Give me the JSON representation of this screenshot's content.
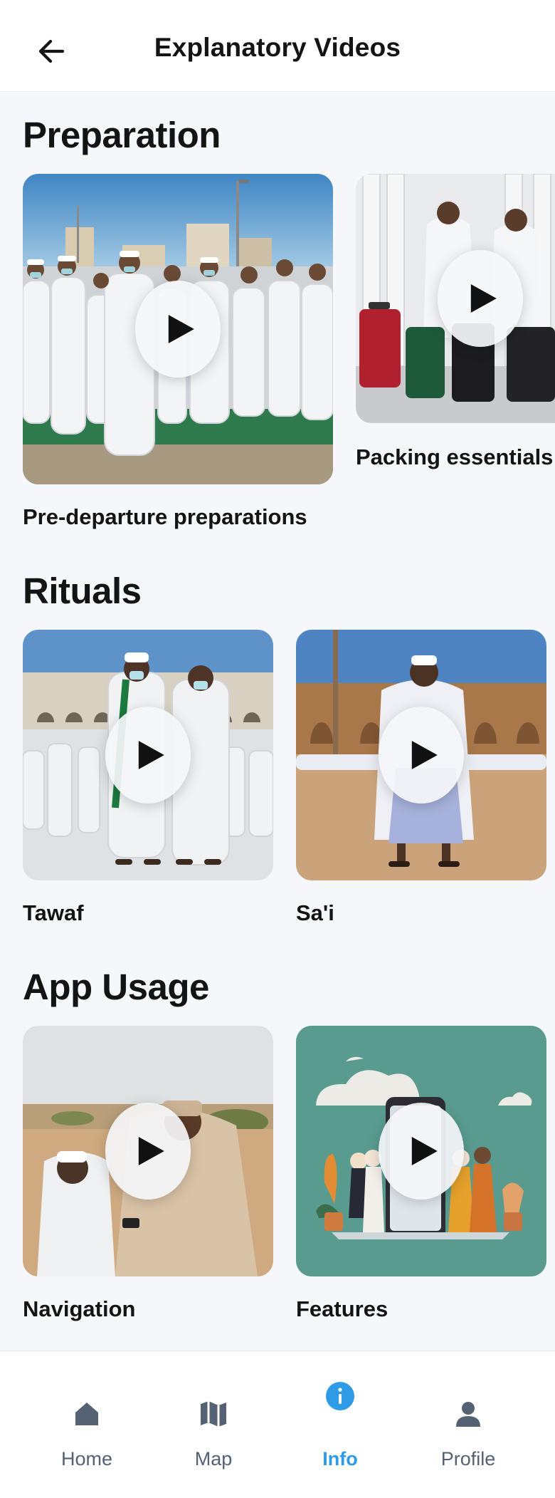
{
  "header": {
    "title": "Explanatory Videos",
    "back_icon": "arrow-left-icon"
  },
  "sections": [
    {
      "title": "Preparation",
      "videos": [
        {
          "title": "Pre-departure preparations"
        },
        {
          "title": "Packing essentials"
        }
      ]
    },
    {
      "title": "Rituals",
      "videos": [
        {
          "title": "Tawaf"
        },
        {
          "title": "Sa'i"
        }
      ]
    },
    {
      "title": "App Usage",
      "videos": [
        {
          "title": "Navigation"
        },
        {
          "title": "Features"
        }
      ]
    }
  ],
  "bottom_nav": {
    "items": [
      {
        "label": "Home",
        "icon": "home-icon"
      },
      {
        "label": "Map",
        "icon": "map-icon"
      },
      {
        "label": "Info",
        "icon": "info-icon",
        "active": true
      },
      {
        "label": "Profile",
        "icon": "profile-icon"
      }
    ]
  },
  "colors": {
    "accent": "#2f9be6",
    "nav_inactive": "#556274",
    "background": "#f6f7fb"
  }
}
